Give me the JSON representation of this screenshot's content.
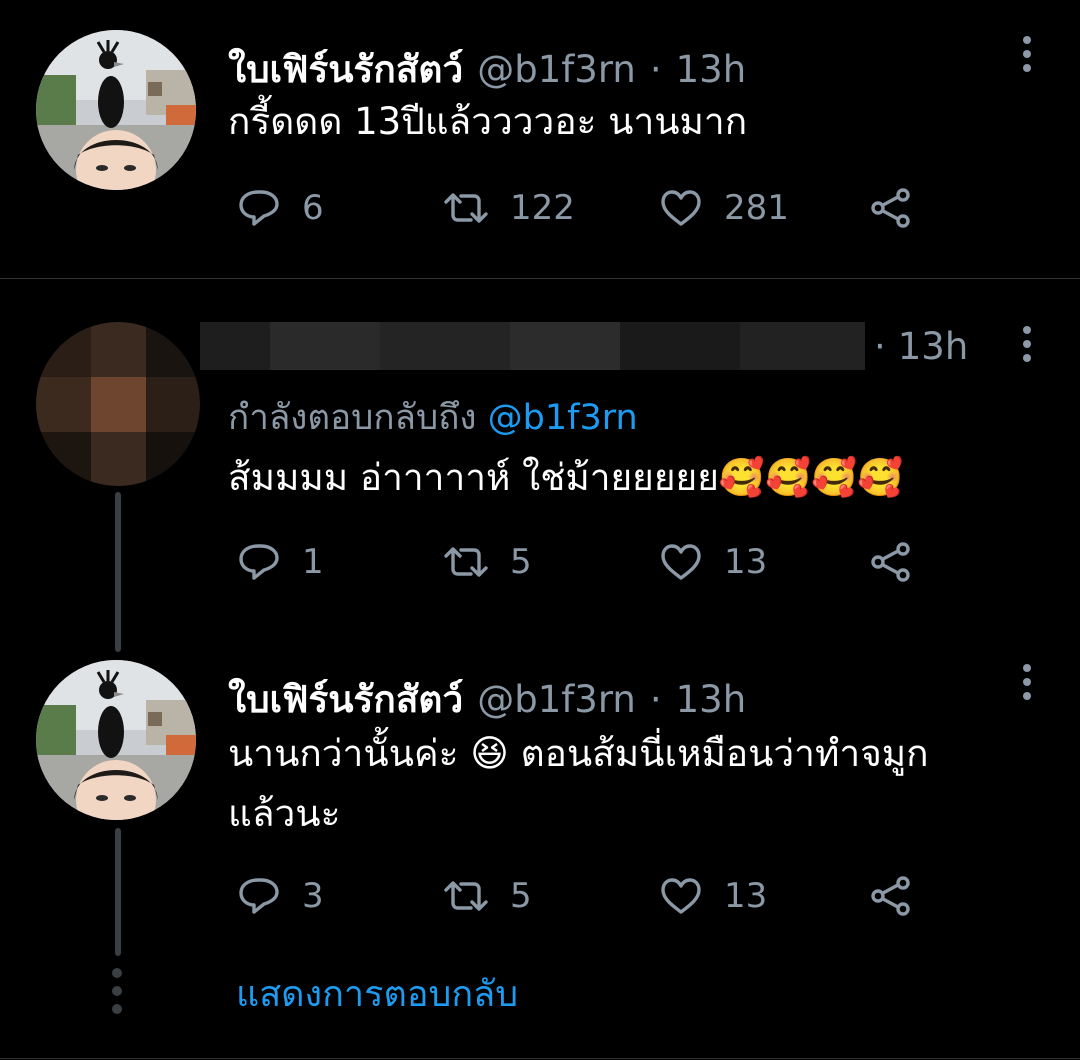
{
  "tweets": [
    {
      "display_name": "ใบเฟิร์นรักสัตว์",
      "handle": "@b1f3rn",
      "dot": "·",
      "time": "13h",
      "text": "กรี้ดดด 13ปีแล้ววววอะ นานมาก",
      "replies": "6",
      "retweets": "122",
      "likes": "281"
    },
    {
      "display_name": "",
      "dot": "·",
      "time": "13h",
      "replying_prefix": "กำลังตอบกลับถึง",
      "replying_mention": "@b1f3rn",
      "text": "ส้มมมม อ่าาาาาห์ ใช่ม้ายยยยย",
      "emoji": "🥰🥰🥰🥰",
      "replies": "1",
      "retweets": "5",
      "likes": "13"
    },
    {
      "display_name": "ใบเฟิร์นรักสัตว์",
      "handle": "@b1f3rn",
      "dot": "·",
      "time": "13h",
      "text_line1_a": "นานกว่านั้นค่ะ",
      "emoji": "😆",
      "text_line1_b": "ตอนส้มนี่เหมือนว่าทำจมูก",
      "text_line2": "แล้วนะ",
      "replies": "3",
      "retweets": "5",
      "likes": "13"
    }
  ],
  "show_replies": "แสดงการตอบกลับ",
  "colors": {
    "accent": "#1d9bf0",
    "muted": "#8b98a5",
    "background": "#000000"
  },
  "icons": [
    "reply-icon",
    "retweet-icon",
    "like-icon",
    "share-icon",
    "more-icon"
  ]
}
